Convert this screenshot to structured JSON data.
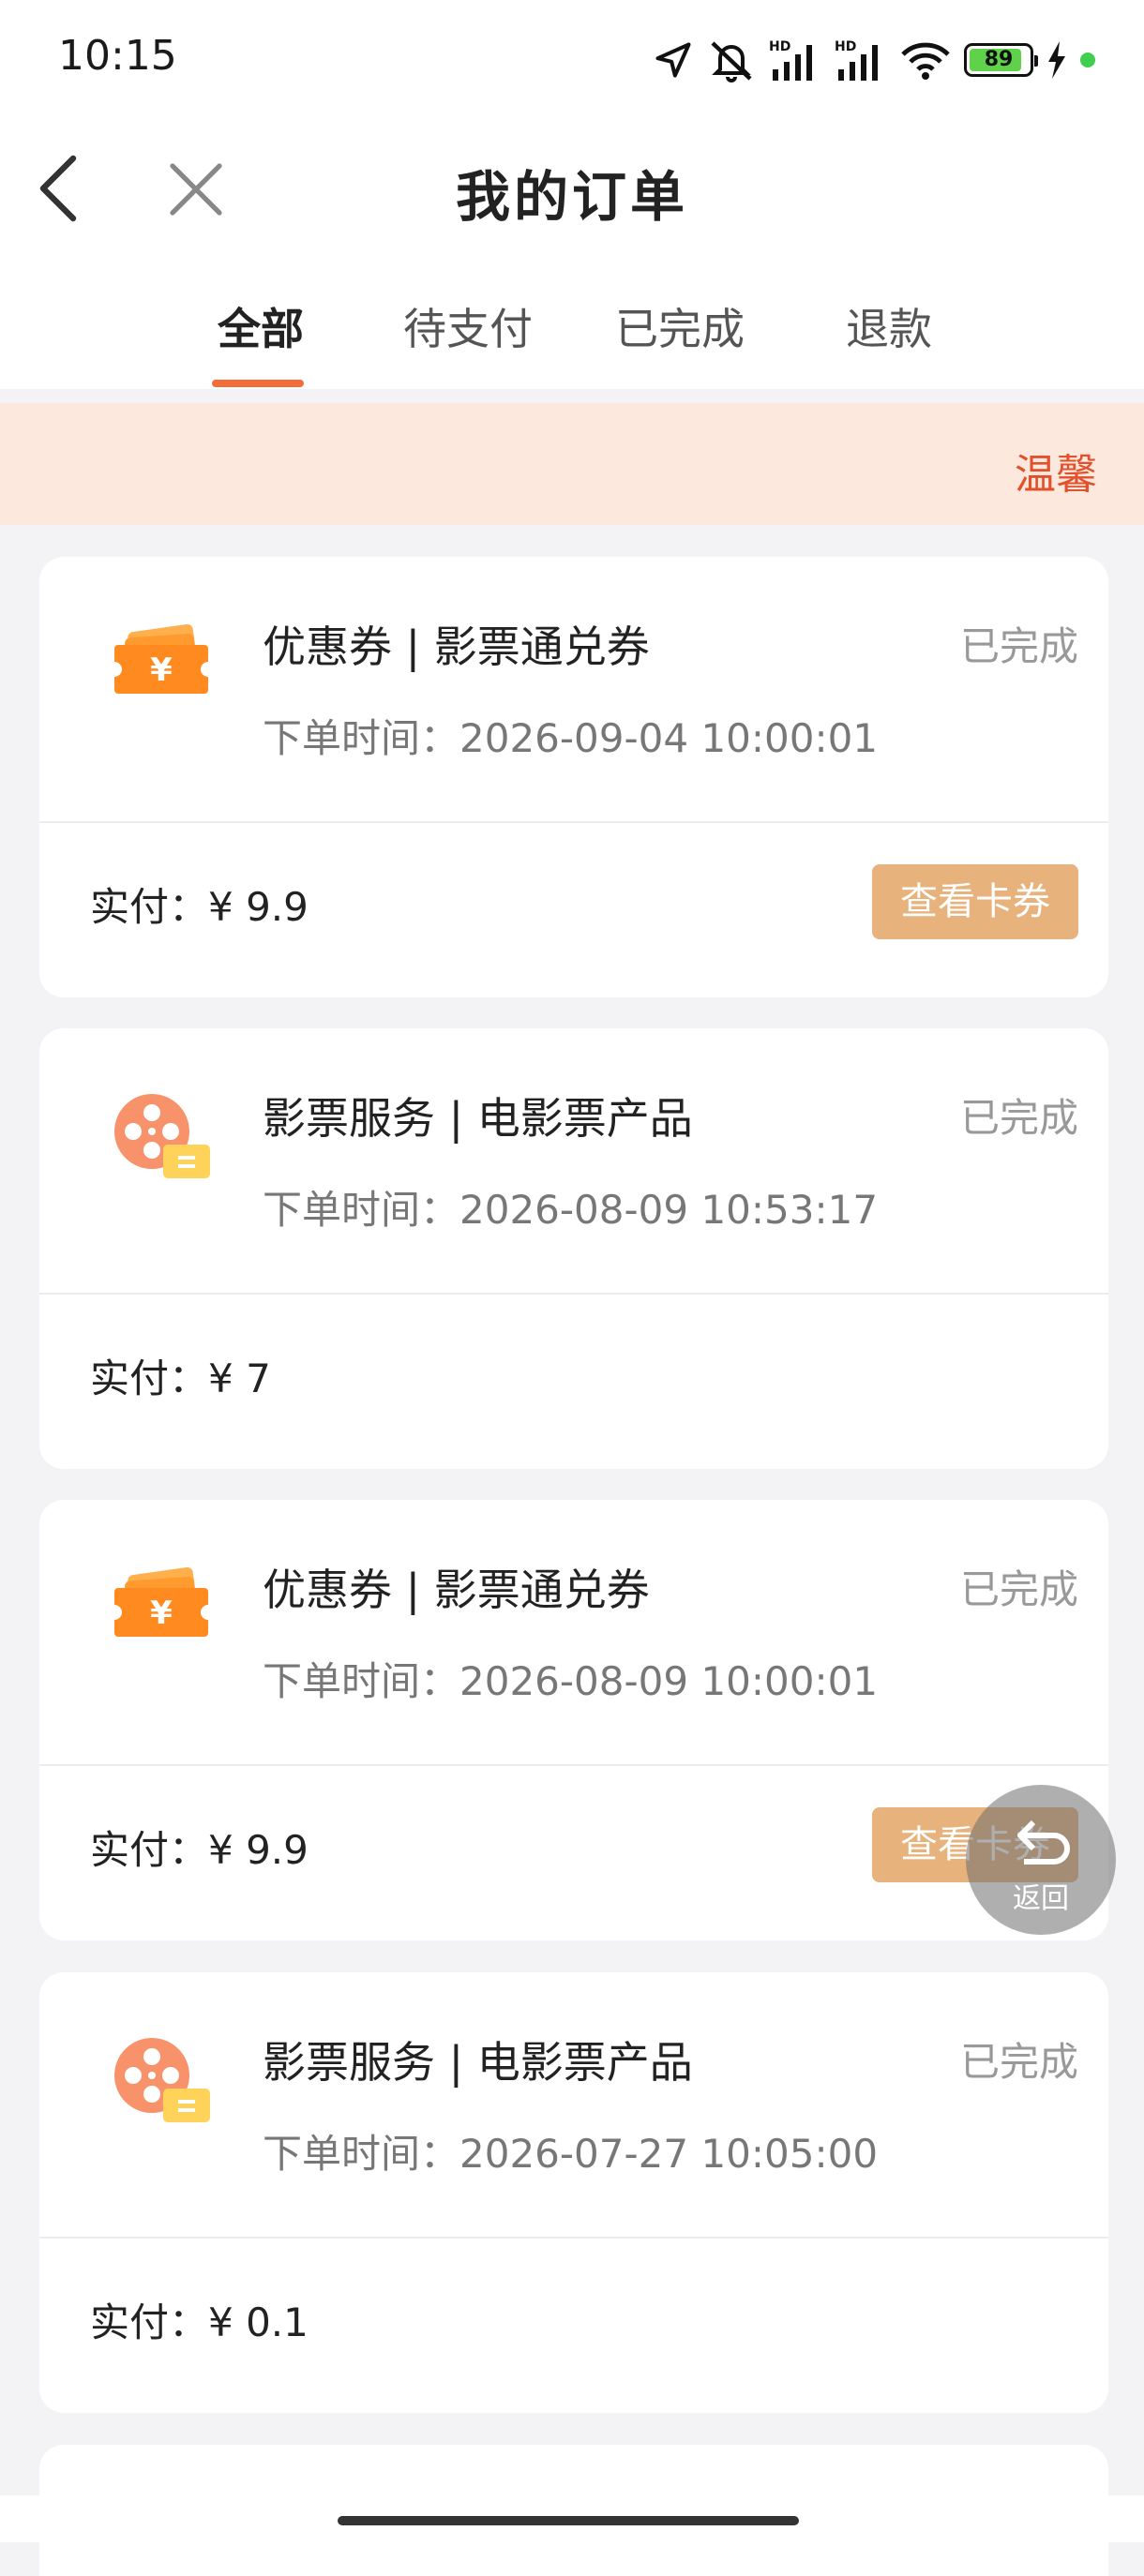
{
  "status_bar": {
    "time": "10:15",
    "battery": "89",
    "battery_level": 0.89,
    "icons": [
      "location-arrow-icon",
      "mute-bell-icon",
      "hd-signal-icon",
      "hd-signal-icon",
      "wifi-icon",
      "battery-icon",
      "charging-icon",
      "notification-dot-icon"
    ]
  },
  "header": {
    "title": "我的订单"
  },
  "tabs": [
    {
      "label": "全部",
      "active": true
    },
    {
      "label": "待支付",
      "active": false
    },
    {
      "label": "已完成",
      "active": false
    },
    {
      "label": "退款",
      "active": false
    }
  ],
  "notice": {
    "text": "温馨"
  },
  "orders": [
    {
      "icon": "coupon-ticket-icon",
      "title": "优惠券 | 影票通兑券",
      "status": "已完成",
      "time_label": "下单时间：",
      "time": "2026-09-04 10:00:01",
      "paid_label": "实付：",
      "paid": "¥ 9.9",
      "action": "查看卡券"
    },
    {
      "icon": "film-reel-ticket-icon",
      "title": "影票服务 | 电影票产品",
      "status": "已完成",
      "time_label": "下单时间：",
      "time": "2026-08-09 10:53:17",
      "paid_label": "实付：",
      "paid": "¥ 7"
    },
    {
      "icon": "coupon-ticket-icon",
      "title": "优惠券 | 影票通兑券",
      "status": "已完成",
      "time_label": "下单时间：",
      "time": "2026-08-09 10:00:01",
      "paid_label": "实付：",
      "paid": "¥ 9.9",
      "action": "查看卡券"
    },
    {
      "icon": "film-reel-ticket-icon",
      "title": "影票服务 | 电影票产品",
      "status": "已完成",
      "time_label": "下单时间：",
      "time": "2026-07-27 10:05:00",
      "paid_label": "实付：",
      "paid": "¥ 0.1"
    }
  ],
  "floating_button": {
    "label": "返回",
    "icon": "return-arrow-icon"
  },
  "colors": {
    "accent": "#f26d3a",
    "notice_bg": "#fde8de",
    "notice_text": "#e2502c",
    "button_bg": "#e8b27c",
    "coupon_orange": "#ff8a1f",
    "film_orange": "#f7926b",
    "film_yellow": "#ffd35a"
  }
}
